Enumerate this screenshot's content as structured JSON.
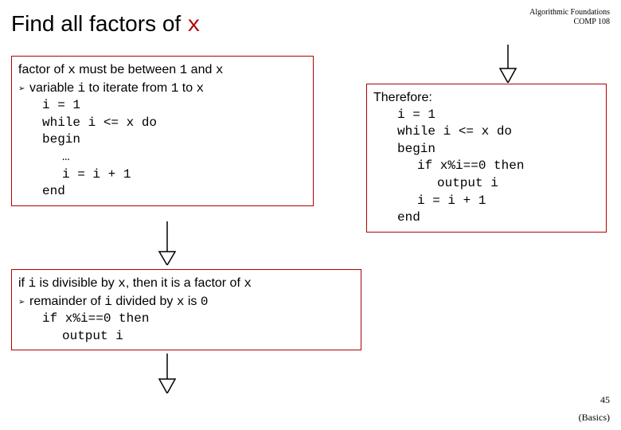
{
  "header": {
    "title_prefix": "Find all factors of ",
    "title_var": "x",
    "course_line1": "Algorithmic Foundations",
    "course_line2": "COMP 108"
  },
  "box1": {
    "line1_a": "factor of ",
    "line1_b": "x",
    "line1_c": " must be between ",
    "line1_d": "1",
    "line1_e": " and ",
    "line1_f": "x",
    "line2_a": "variable ",
    "line2_b": "i",
    "line2_c": " to iterate from ",
    "line2_d": "1",
    "line2_e": " to ",
    "line2_f": "x",
    "code1": "i = 1",
    "code2": "while i <= x do",
    "code3": "begin",
    "code4": "…",
    "code5": "i = i + 1",
    "code6": "end"
  },
  "box2": {
    "line1_a": "if ",
    "line1_b": "i",
    "line1_c": " is divisible by ",
    "line1_d": "x",
    "line1_e": ", then it is a factor of ",
    "line1_f": "x",
    "line2_a": "remainder of ",
    "line2_b": "i",
    "line2_c": " divided by ",
    "line2_d": "x",
    "line2_e": " is ",
    "line2_f": "0",
    "code1": "if x%i==0 then",
    "code2": "output i"
  },
  "box3": {
    "line1": "Therefore:",
    "code1": "i = 1",
    "code2": "while i <= x do",
    "code3": "begin",
    "code4": "if x%i==0 then",
    "code5": "output i",
    "code6": "i = i + 1",
    "code7": "end"
  },
  "footer": {
    "slide_num": "45",
    "basics": "(Basics)"
  }
}
